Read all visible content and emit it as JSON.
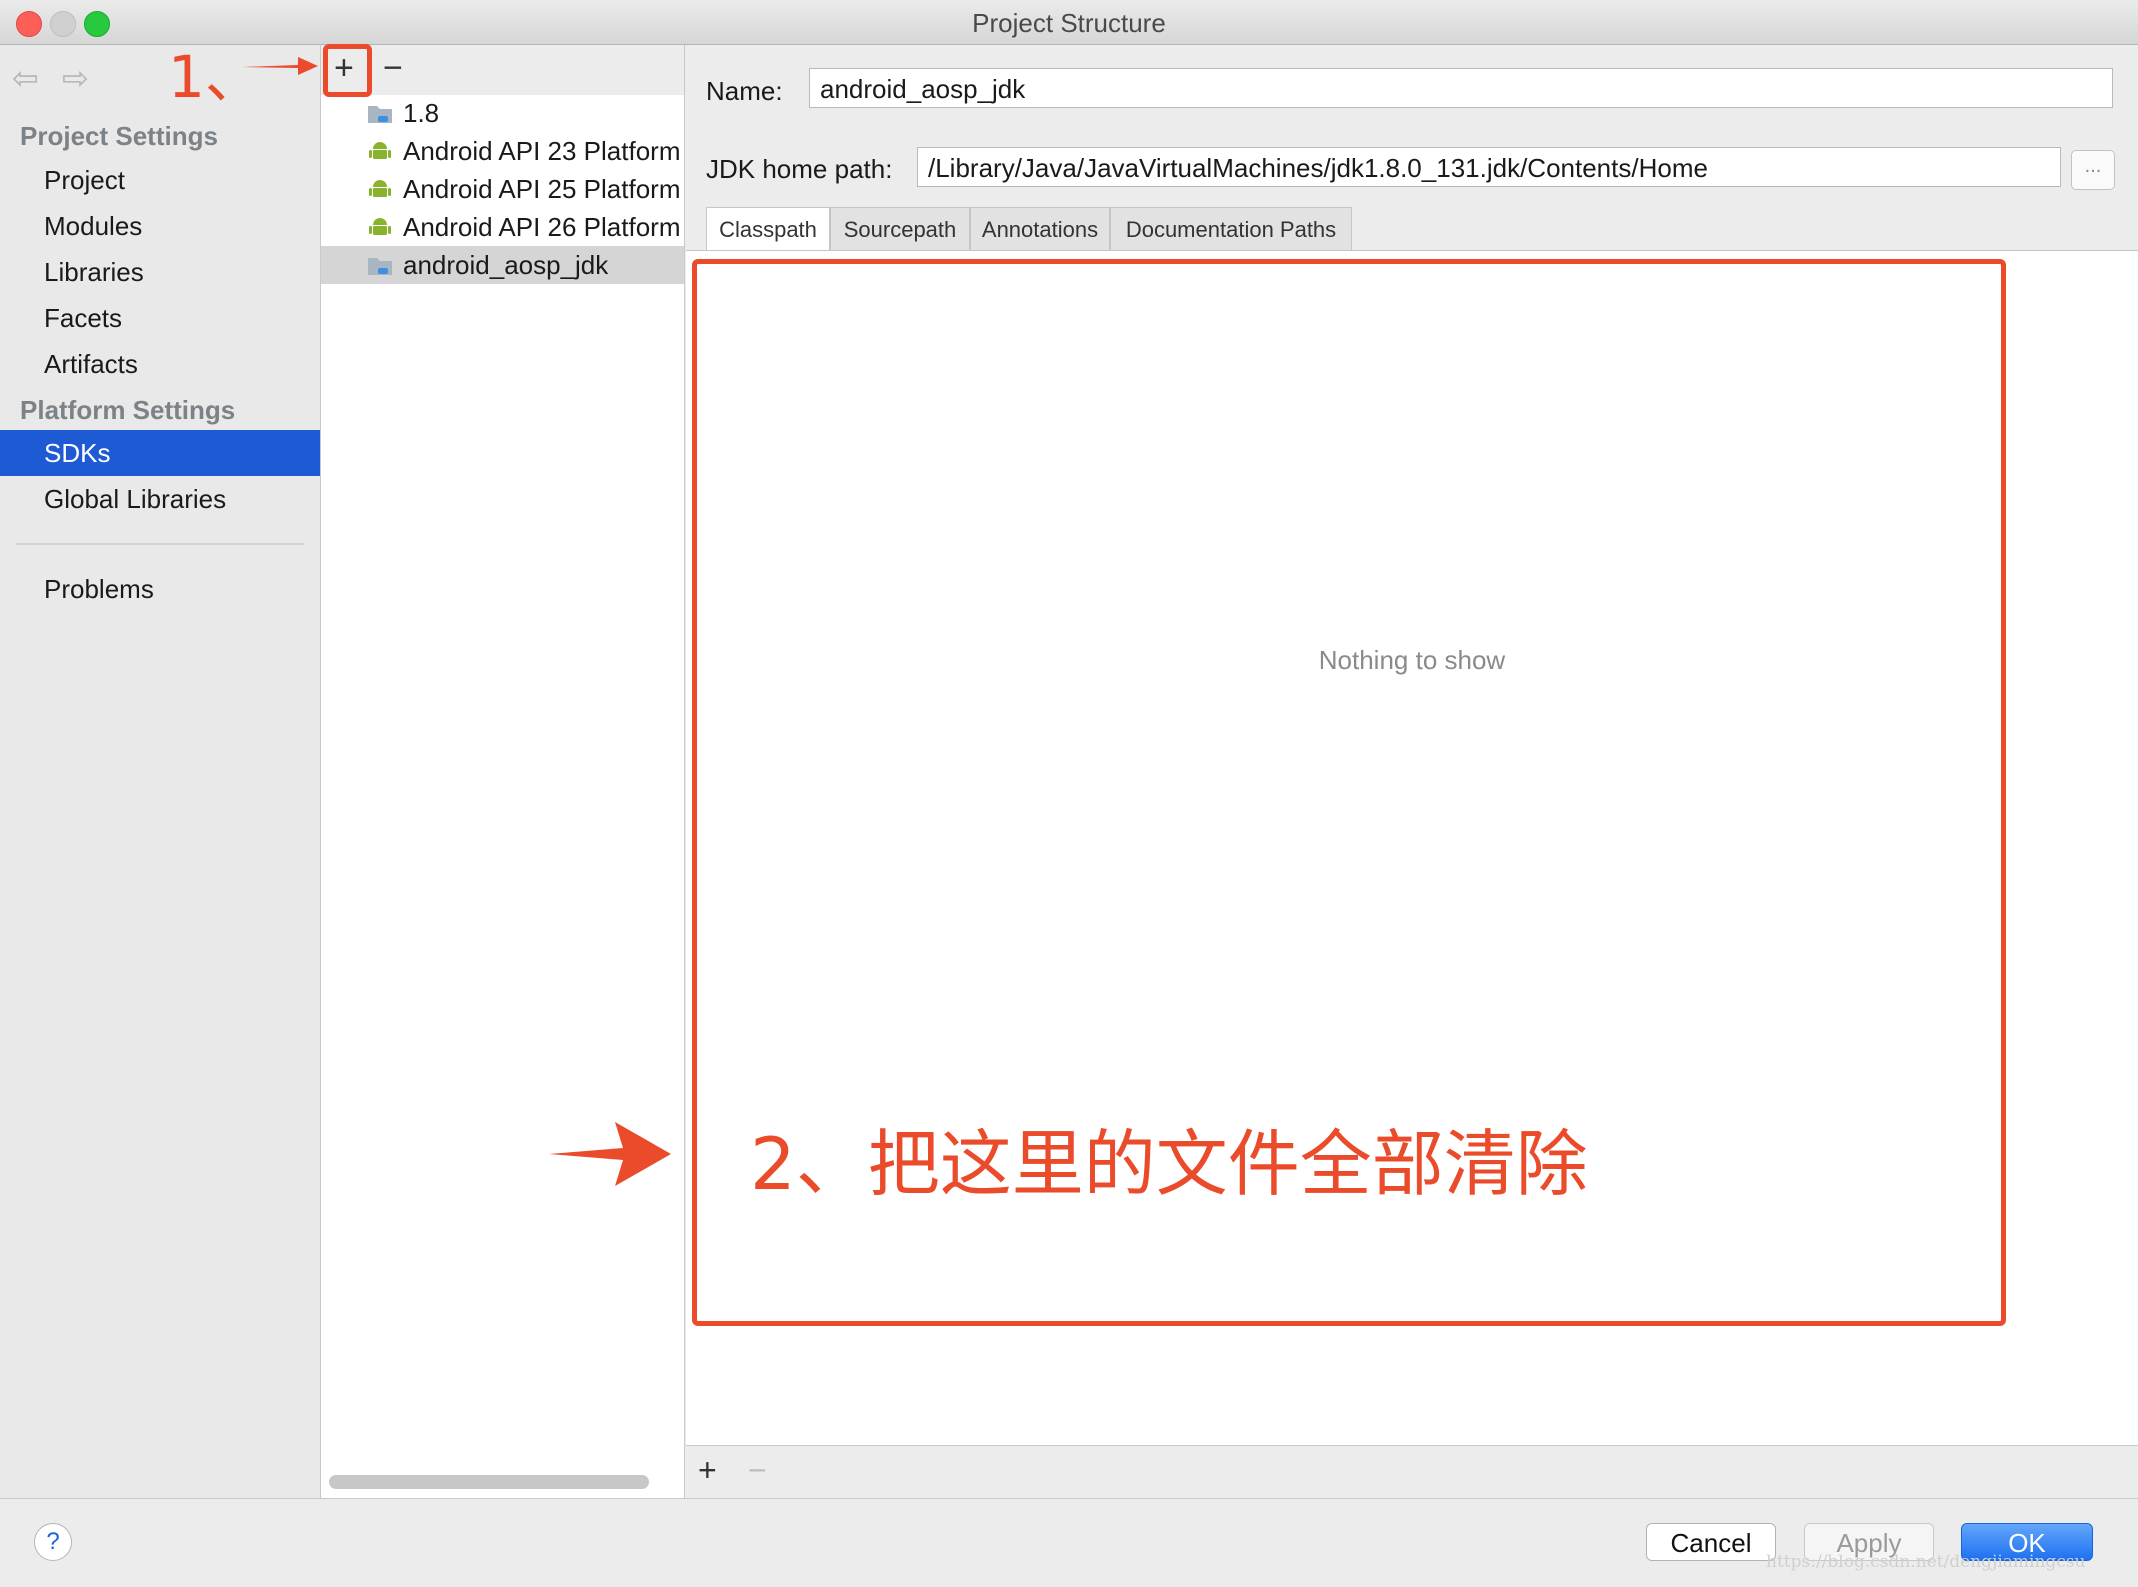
{
  "window": {
    "title": "Project Structure"
  },
  "sidebar": {
    "back_icon": "back-arrow-icon",
    "forward_icon": "forward-arrow-icon",
    "project_settings_header": "Project Settings",
    "project_items": [
      {
        "label": "Project"
      },
      {
        "label": "Modules"
      },
      {
        "label": "Libraries"
      },
      {
        "label": "Facets"
      },
      {
        "label": "Artifacts"
      }
    ],
    "platform_settings_header": "Platform Settings",
    "platform_items": [
      {
        "label": "SDKs",
        "selected": true
      },
      {
        "label": "Global Libraries"
      }
    ],
    "problems_label": "Problems"
  },
  "sdk_list": {
    "add_label": "+",
    "remove_label": "−",
    "items": [
      {
        "label": "1.8",
        "icon": "jdk-folder-icon"
      },
      {
        "label": "Android API 23 Platform",
        "icon": "android-icon"
      },
      {
        "label": "Android API 25 Platform",
        "icon": "android-icon"
      },
      {
        "label": "Android API 26 Platform",
        "icon": "android-icon"
      },
      {
        "label": "android_aosp_jdk",
        "icon": "jdk-folder-icon",
        "selected": true
      }
    ]
  },
  "detail": {
    "name_label": "Name:",
    "name_value": "android_aosp_jdk",
    "jdk_home_label": "JDK home path:",
    "jdk_home_value": "/Library/Java/JavaVirtualMachines/jdk1.8.0_131.jdk/Contents/Home",
    "browse_label": "...",
    "tabs": [
      {
        "label": "Classpath",
        "active": true
      },
      {
        "label": "Sourcepath"
      },
      {
        "label": "Annotations"
      },
      {
        "label": "Documentation Paths"
      }
    ],
    "empty_message": "Nothing to show",
    "add_label": "+",
    "remove_label": "−"
  },
  "footer": {
    "help_label": "?",
    "cancel_label": "Cancel",
    "apply_label": "Apply",
    "ok_label": "OK",
    "watermark": "https://blog.csdn.net/dengjiamingcsu"
  },
  "annotations": {
    "step1": "1、",
    "step2": "2、把这里的文件全部清除",
    "color": "#ea4b2a"
  }
}
